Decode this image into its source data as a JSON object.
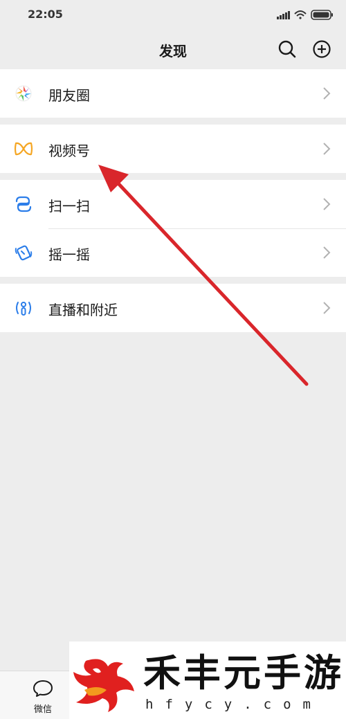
{
  "status_bar": {
    "time": "22:05"
  },
  "nav": {
    "title": "发现",
    "search_icon": "search-icon",
    "add_icon": "plus-circle-icon"
  },
  "menu": {
    "moments": {
      "label": "朋友圈",
      "icon": "moments-icon"
    },
    "channels": {
      "label": "视频号",
      "icon": "channels-icon"
    },
    "scan": {
      "label": "扫一扫",
      "icon": "scan-icon"
    },
    "shake": {
      "label": "摇一摇",
      "icon": "shake-icon"
    },
    "nearby": {
      "label": "直播和附近",
      "icon": "live-nearby-icon"
    }
  },
  "tabbar": {
    "chats_label": "微信"
  },
  "watermark": {
    "name": "禾丰元手游",
    "url": "hfycy.com"
  },
  "colors": {
    "background": "#ededed",
    "row_background": "#ffffff",
    "arrow": "#d9262b",
    "channels_icon": "#f5a623",
    "icon_blue": "#2b7de9"
  }
}
